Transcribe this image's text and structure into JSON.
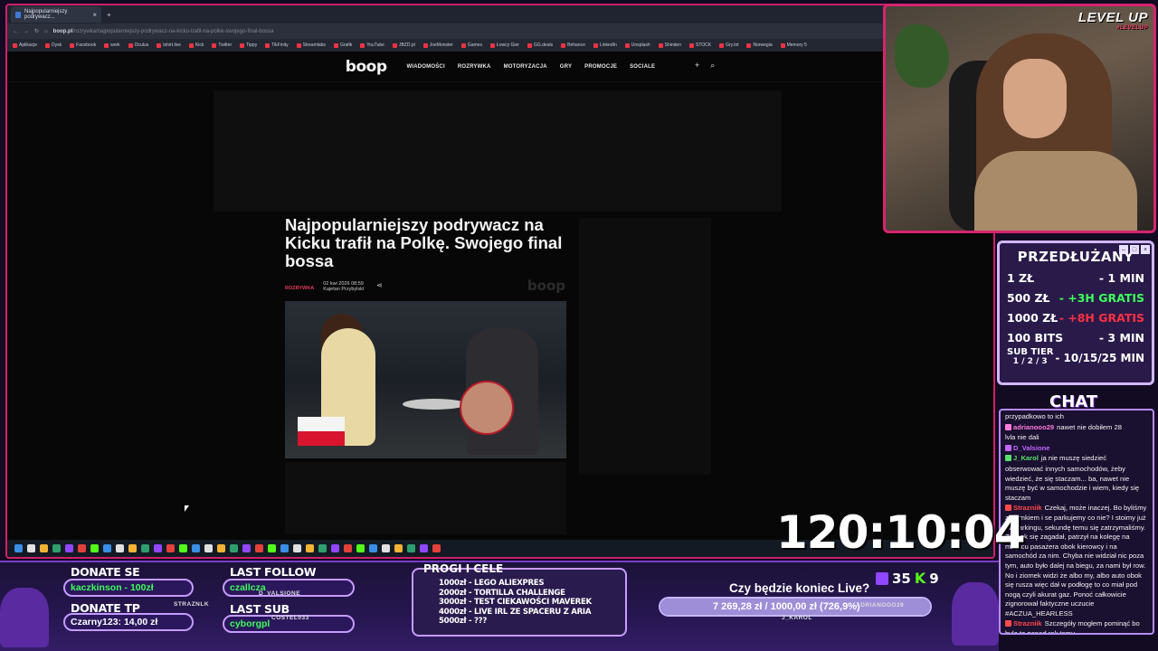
{
  "browser": {
    "tab_title": "Najpopularniejszy podrywacz...",
    "tab_close": "×",
    "new_tab": "+",
    "url_host": "boop.pl",
    "url_path": "/rozrywka/najpopularniejszy-podrywacz-na-kicku-trafil-na-polke-swojego-final-bossa",
    "bookmarks": [
      "Aplikacje",
      "Dysk",
      "Facebook",
      "work",
      "Oculus",
      "tshirt.live",
      "Kick",
      "Twitter",
      "Tippy",
      "TikFinity",
      "Streamlabs",
      "Grafik",
      "YouTube",
      "JBZD.pl",
      "JoeMonster",
      "Games",
      "Łowcy Gier",
      "GG.deals",
      "Behance",
      "LinkedIn",
      "Unsplash",
      "Shinden",
      "STOCK",
      "Gry.txt",
      "Norwegia",
      "Memory 5"
    ]
  },
  "site": {
    "logo": "boop",
    "nav": [
      "WIADOMOŚCI",
      "ROZRYWKA",
      "MOTORYZACJA",
      "GRY",
      "PROMOCJE",
      "SOCIALE"
    ],
    "plus_icon": "+",
    "search_icon": "⌕",
    "headline": "Najpopularniejszy podrywacz na Kicku trafił na Polkę. Swojego final bossa",
    "category": "ROZRYWKA",
    "date": "02 kwi 2026 08:59",
    "author": "Kajetan Przybylski",
    "share_icon": "⋖",
    "watermark": "boop"
  },
  "overlay": {
    "level_up": "LEVEL UP",
    "level_up_sub": "#LEVELUP",
    "subathon_title": "PRZEDŁUŻANY",
    "subathon_rows": [
      {
        "left": "1 ZŁ",
        "right": "- 1 MIN",
        "color": "white"
      },
      {
        "left": "500 ZŁ",
        "right": "- +3H GRATIS",
        "color": "green"
      },
      {
        "left": "1000 ZŁ",
        "right": "- +8H GRATIS",
        "color": "red"
      },
      {
        "left": "100 BITS",
        "right": "- 3 MIN",
        "color": "white"
      }
    ],
    "sub_tier_label": "SUB TIER",
    "sub_tier_levels": "1 / 2 / 3",
    "sub_tier_values": "- 10/15/25 MIN",
    "timer": "120:10:04",
    "chat_title": "CHAT",
    "chat": [
      {
        "user": "",
        "color": "#ffffff",
        "text": "przypadkowo to ich"
      },
      {
        "user": "adrianooo29",
        "color": "#ff7ad9",
        "text": "nawet nie dobiłem 28"
      },
      {
        "user": "",
        "color": "#ffffff",
        "text": "lvla nie dali"
      },
      {
        "user": "D_Valsione",
        "color": "#c266ff",
        "text": ""
      },
      {
        "user": "J_Karol",
        "color": "#56e06a",
        "text": "ja nie muszę siedzieć"
      },
      {
        "user": "",
        "color": "#ffffff",
        "text": "obserwować innych samochodów, żeby wiedzieć, że się staczam... ba, nawet nie muszę być w samochodzie i wiem, kiedy się staczam"
      },
      {
        "user": "Strazniik",
        "color": "#ff4a4a",
        "text": "Czekaj, może inaczej. Bo byliśmy z ziomkiem i se parkujemy co nie? I stoimy już na parkingu, sekundę temu się zatrzymaliśmy. Ziomek się zagadał, patrzył na kolegę na miejscu pasażera obok kierowcy i na samochód za nim. Chyba nie widział nic poza tym, auto było dalej na biegu, za nami był row. No i ziomek widzi że albo my, albo auto obok się rusza więc dał w podłogę to co miał pod nogą czyli akurat gaz. Ponoć całkowicie zignorował faktyczne uczucie #ACZUA_HEARLESS"
      },
      {
        "user": "Strazniik",
        "color": "#ff4a4a",
        "text": "Szczegóły mogłem pominąć bo było to ponad rok temu"
      }
    ],
    "donate_se_label": "DONATE SE",
    "donate_se_value": "kaczkinson - 100zł",
    "donate_tp_label": "DONATE TP",
    "donate_tp_value": "Czarny123: 14,00 zł",
    "last_follow_label": "LAST FOLLOW",
    "last_follow_value": "czallcza",
    "last_sub_label": "LAST SUB",
    "last_sub_value": "cyborgpl",
    "tag_valsione": "D_VALSIONE",
    "tag_straznik": "STRAZNLK",
    "tag_costel": "COSTEL033",
    "tag_adrianooo": "ADRIANOOO29",
    "tag_karol": "J_KAROL",
    "goals_title": "PROGI I CELE",
    "goals": [
      "1000zł - LEGO ALIEXPRES",
      "2000zł - TORTILLA CHALLENGE",
      "3000zł - TEST CIEKAWOŚCI MAVEREK",
      "4000zł - LIVE IRL ZE SPACERU Z ARIA",
      "5000zł - ???"
    ],
    "konlive_question": "Czy będzie koniec Live?",
    "konlive_value": "7 269,28 zł / 1000,00 zł (726,9%)",
    "konlive_fraction": 1.0,
    "viewers_twitch": "35",
    "viewers_kick": "9",
    "kick_glyph": "K"
  },
  "colors": {
    "frame": "#d01f6a",
    "accent_purple": "#7a3cc8",
    "kick_green": "#53fc18",
    "twitch_purple": "#9146ff"
  }
}
